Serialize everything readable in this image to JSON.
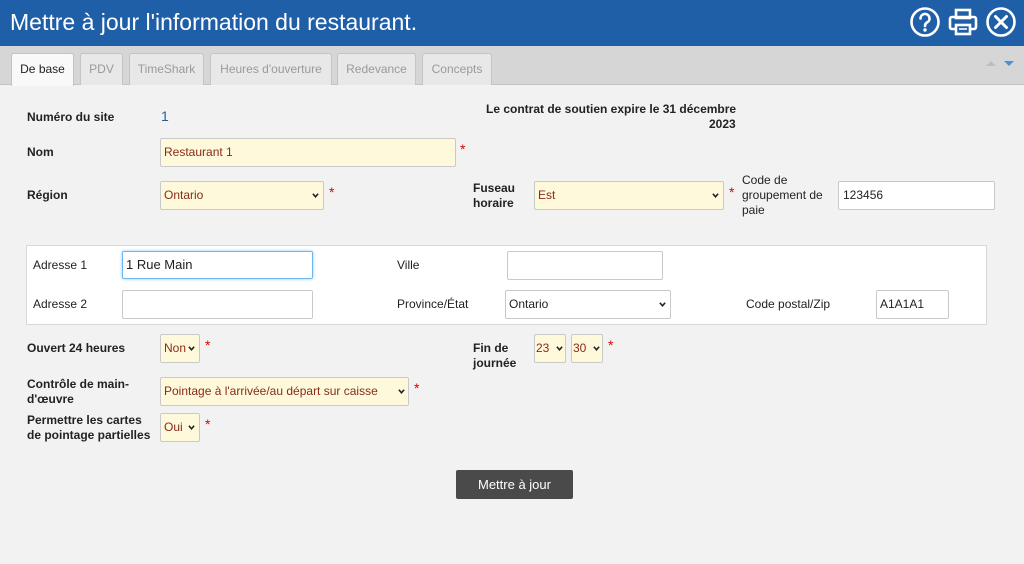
{
  "window": {
    "title": "Mettre à jour l'information du restaurant."
  },
  "header_icons": [
    "help-icon",
    "print-icon",
    "close-icon"
  ],
  "tabs": [
    {
      "label": "De base",
      "active": true
    },
    {
      "label": "PDV",
      "active": false
    },
    {
      "label": "TimeShark",
      "active": false
    },
    {
      "label": "Heures d'ouverture",
      "active": false
    },
    {
      "label": "Redevance",
      "active": false
    },
    {
      "label": "Concepts",
      "active": false
    }
  ],
  "form": {
    "site_number_label": "Numéro du site",
    "site_number_value": "1",
    "contract_notice_line1": "Le contrat de soutien expire le 31 décembre",
    "contract_notice_line2": "2023",
    "name_label": "Nom",
    "name_value": "Restaurant 1",
    "region_label": "Région",
    "region_value": "Ontario",
    "timezone_label_line1": "Fuseau",
    "timezone_label_line2": "horaire",
    "timezone_value": "Est",
    "paygroup_label_line1": "Code de",
    "paygroup_label_line2": "groupement de",
    "paygroup_label_line3": "paie",
    "paygroup_value": "123456",
    "open24_label": "Ouvert 24 heures",
    "open24_value": "Non",
    "endofday_label_line1": "Fin de",
    "endofday_label_line2": "journée",
    "endofday_hour": "23",
    "endofday_minute": "30",
    "labor_label_line1": "Contrôle de main-",
    "labor_label_line2": "d'œuvre",
    "labor_value": "Pointage à l'arrivée/au départ sur caisse",
    "partial_label_line1": "Permettre les cartes",
    "partial_label_line2": "de pointage partielles",
    "partial_value": "Oui",
    "required_mark": "*"
  },
  "address": {
    "address1_label": "Adresse 1",
    "address1_value": "1 Rue Main",
    "address2_label": "Adresse 2",
    "address2_value": "",
    "city_label": "Ville",
    "city_value": "",
    "province_label": "Province/État",
    "province_value": "Ontario",
    "postal_label": "Code postal/Zip",
    "postal_value": "A1A1A1"
  },
  "update_button": "Mettre à jour",
  "colors": {
    "header": "#1f5fa8",
    "required": "#dd0000",
    "field_bg": "#fdf9da",
    "button": "#4a4a4a"
  }
}
